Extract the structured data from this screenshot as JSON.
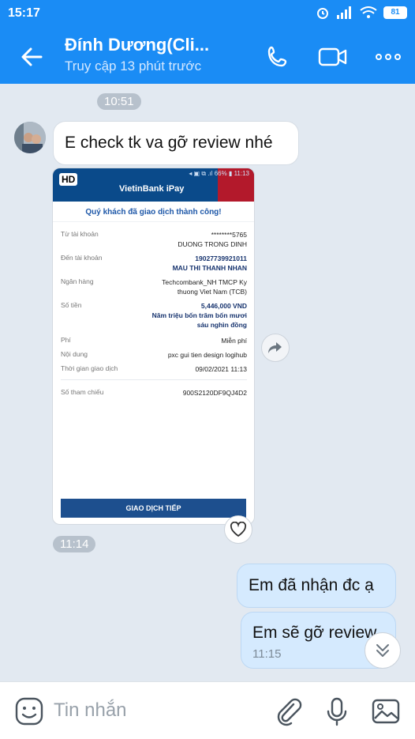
{
  "status_bar": {
    "time": "15:17",
    "battery": "81"
  },
  "header": {
    "contact_name": "Đính Dương(Cli...",
    "last_seen": "Truy cập 13 phút trước"
  },
  "chat": {
    "time_divider_1": "10:51",
    "incoming_text": "E check tk va gỡ review nhé",
    "image_time": "11:14",
    "outgoing_1": "Em đã nhận đc ạ",
    "outgoing_2": "Em sẽ gỡ review",
    "outgoing_2_time": "11:15"
  },
  "receipt": {
    "hd_badge": "HD",
    "system_bar": "◂ ▣ ⧉ .ıl 66% ▮ 11:13",
    "bank_logo": "VietinBank iPay",
    "success_title": "Quý khách đã giao dịch thành công!",
    "rows": [
      {
        "label": "Từ tài khoản",
        "value1": "********5765",
        "value2": "DUONG TRONG DINH"
      },
      {
        "label": "Đến tài khoản",
        "value1": "19027739921011",
        "value2": "MAU THI THANH NHAN"
      },
      {
        "label": "Ngân hàng",
        "value1": "Techcombank_NH TMCP Ky",
        "value2": "thuong Viet Nam (TCB)"
      },
      {
        "label": "Số tiền",
        "value1": "5,446,000 VND",
        "value2": "Năm triệu bốn trăm bốn mươi",
        "value3": "sáu nghìn đồng"
      },
      {
        "label": "Phí",
        "value1": "Miễn phí"
      },
      {
        "label": "Nội dung",
        "value1": "pxc gui tien design logihub"
      },
      {
        "label": "Thời gian giao dịch",
        "value1": "09/02/2021 11:13"
      },
      {
        "label": "Số tham chiếu",
        "value1": "900S2120DF9QJ4D2"
      }
    ],
    "button": "GIAO DỊCH TIẾP"
  },
  "input_bar": {
    "placeholder": "Tin nhắn"
  },
  "icons": [
    "back-arrow-icon",
    "phone-icon",
    "video-call-icon",
    "more-icon",
    "share-icon",
    "heart-icon",
    "scroll-down-icon",
    "sticker-icon",
    "attach-icon",
    "mic-icon",
    "image-icon"
  ],
  "colors": {
    "header_blue": "#1a8cf5",
    "chat_bg": "#e2e9f1",
    "outgoing_bubble": "#d5eafe"
  }
}
